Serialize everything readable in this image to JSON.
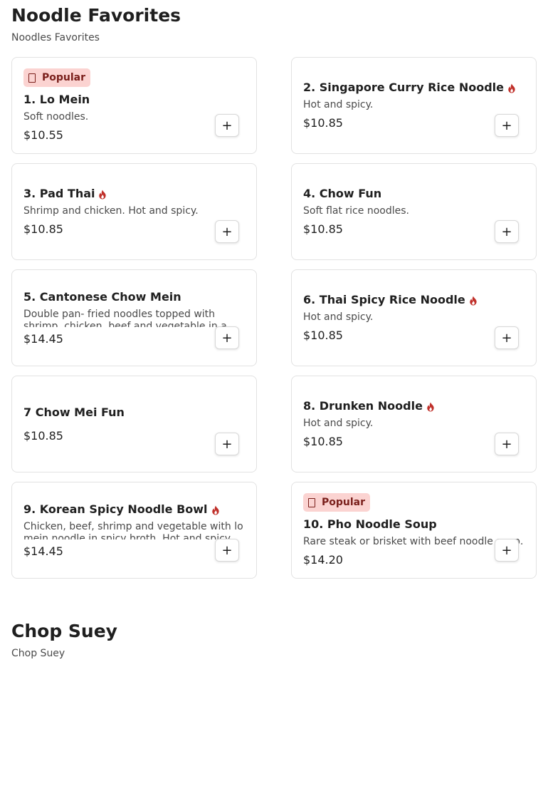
{
  "sections": [
    {
      "title": "Noodle Favorites",
      "subtitle": "Noodles Favorites",
      "items": [
        {
          "name": "1. Lo Mein",
          "desc": "Soft noodles.",
          "price": "$10.55",
          "badge": "Popular",
          "spicy": false
        },
        {
          "name": "2. Singapore Curry Rice Noodle",
          "desc": "Hot and spicy.",
          "price": "$10.85",
          "badge": null,
          "spicy": true
        },
        {
          "name": "3. Pad Thai",
          "desc": "Shrimp and chicken. Hot and spicy.",
          "price": "$10.85",
          "badge": null,
          "spicy": true
        },
        {
          "name": "4. Chow Fun",
          "desc": "Soft flat rice noodles.",
          "price": "$10.85",
          "badge": null,
          "spicy": false
        },
        {
          "name": "5. Cantonese Chow Mein",
          "desc": "Double pan- fried noodles topped with shrimp, chicken, beef and vegetable in a",
          "price": "$14.45",
          "badge": null,
          "spicy": false
        },
        {
          "name": "6. Thai Spicy Rice Noodle",
          "desc": "Hot and spicy.",
          "price": "$10.85",
          "badge": null,
          "spicy": true
        },
        {
          "name": "7 Chow Mei Fun",
          "desc": "",
          "price": "$10.85",
          "badge": null,
          "spicy": false
        },
        {
          "name": "8. Drunken Noodle",
          "desc": "Hot and spicy.",
          "price": "$10.85",
          "badge": null,
          "spicy": true
        },
        {
          "name": "9. Korean Spicy Noodle Bowl",
          "desc": "Chicken, beef, shrimp and vegetable with lo mein noodle in spicy broth. Hot and spicy.",
          "price": "$14.45",
          "badge": null,
          "spicy": true
        },
        {
          "name": "10. Pho Noodle Soup",
          "desc": "Rare steak or brisket with beef noodle soup.",
          "price": "$14.20",
          "badge": "Popular",
          "spicy": false
        }
      ]
    },
    {
      "title": "Chop Suey",
      "subtitle": "Chop Suey",
      "items": []
    }
  ],
  "add_label": "+",
  "icons": {
    "spicy": "flame-icon",
    "badge": "popular-icon",
    "add": "plus-icon"
  },
  "colors": {
    "badge_bg": "#fbd3d1",
    "badge_text": "#7a1f1b",
    "flame": "#c0302a",
    "border": "#e2e2e2"
  }
}
